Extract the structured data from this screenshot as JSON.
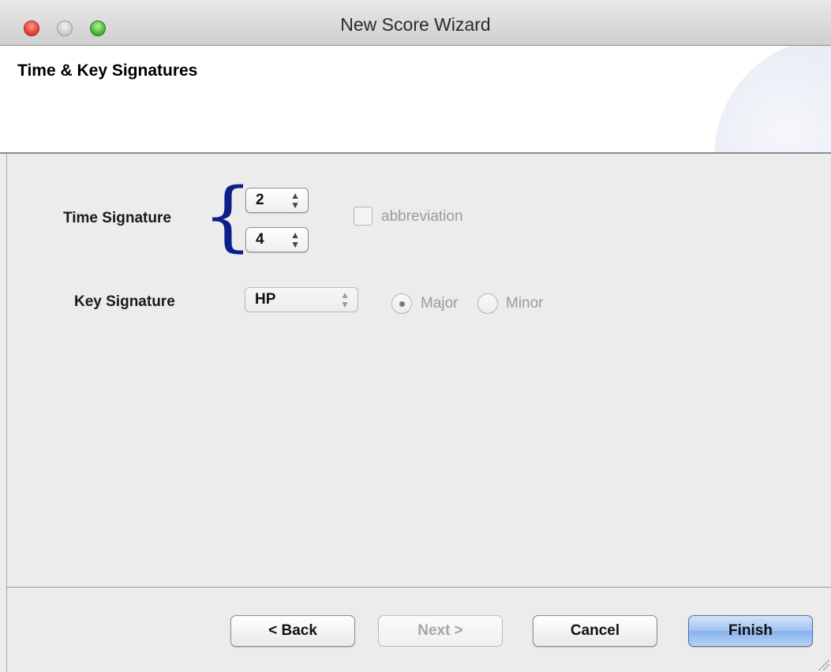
{
  "window": {
    "title": "New Score Wizard"
  },
  "header": {
    "page_title": "Time & Key Signatures"
  },
  "time_signature": {
    "label": "Time Signature",
    "numerator": "2",
    "denominator": "4",
    "abbreviation_label": "abbreviation",
    "abbreviation_checked": false
  },
  "key_signature": {
    "label": "Key Signature",
    "selected": "HP",
    "major_label": "Major",
    "minor_label": "Minor",
    "mode_selected": "Major"
  },
  "footer": {
    "back_label": "< Back",
    "next_label": "Next >",
    "cancel_label": "Cancel",
    "finish_label": "Finish"
  },
  "colors": {
    "brace": "#0a1f8c",
    "default_button": "#86b1ec",
    "disabled_text": "#9b9b9b"
  }
}
